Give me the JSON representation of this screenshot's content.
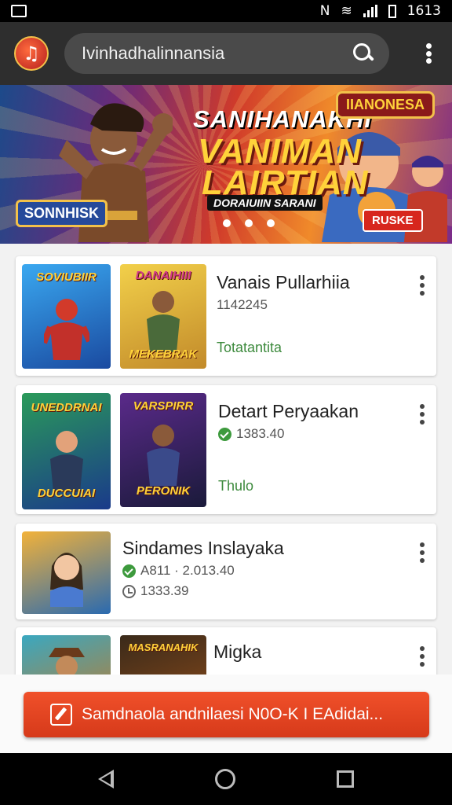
{
  "status_bar": {
    "time": "1613"
  },
  "app_bar": {
    "logo_icon": "music-note-icon",
    "search_text": "Ivinhadhalinnansia",
    "search_icon": "search-icon",
    "menu_icon": "more-vert-icon"
  },
  "banner": {
    "title": "SANIHANAKHI",
    "subtitle_line1": "VANIMAN",
    "subtitle_line2": "LAIRTIAN",
    "tagline": "DORAIUIIN SARANI",
    "badge_top": "IIANONESA",
    "badge_left": "SONNHISK",
    "button": "RUSKE",
    "page_count": 3,
    "active_page": 0
  },
  "items": [
    {
      "title": "Vanais Pullarhiia",
      "meta": "1142245",
      "meta_icon": "none",
      "tag": "Totatantita",
      "thumb1_label": "SOVIUBIIR",
      "thumb2_label": "MEKEBRAK",
      "thumb2_top": "DANAIHIII"
    },
    {
      "title": "Detart Peryaakan",
      "meta": "1383.40",
      "meta_icon": "check-circle-icon",
      "tag": "Thulo",
      "thumb1_label": "DUCCUIAI",
      "thumb1_top": "UNEDDRNAI",
      "thumb2_label": "PERONIK",
      "thumb2_top": "VARSPIRR"
    },
    {
      "title": "Sindames Inslayaka",
      "meta": "A811 · 2.013.40",
      "meta_icon": "check-circle-icon",
      "meta2": "1333.39",
      "meta2_icon": "clock-icon"
    },
    {
      "title": "Migka",
      "thumb2_top": "MASRANAHIK"
    }
  ],
  "bottom_button": {
    "label": "Samdnaola andnilaesi N0O-K I EAdidai...",
    "icon": "edit-icon"
  },
  "nav": {
    "back": "back-icon",
    "home": "home-icon",
    "recents": "recents-icon"
  }
}
